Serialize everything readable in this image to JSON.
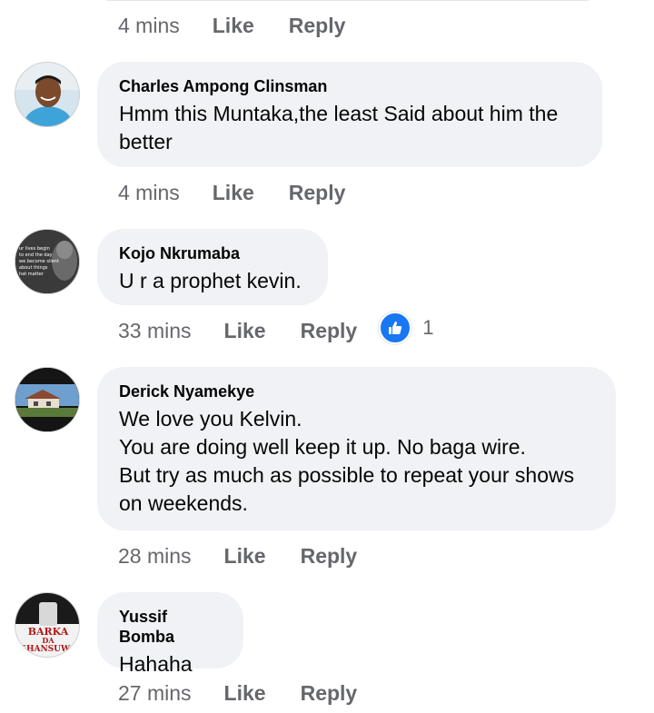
{
  "first_meta": {
    "time": "4 mins",
    "like": "Like",
    "reply": "Reply"
  },
  "comments": [
    {
      "author": "Charles Ampong Clinsman",
      "text": "Hmm this Muntaka,the least Said about him the better",
      "time": "4 mins",
      "like": "Like",
      "reply": "Reply"
    },
    {
      "author": "Kojo Nkrumaba",
      "text": "U r a prophet kevin.",
      "time": "33 mins",
      "like": "Like",
      "reply": "Reply",
      "reaction_count": "1",
      "avatar_text": [
        "ur lives begin",
        "to end the day",
        "we become silent",
        "about things",
        "hat matter"
      ]
    },
    {
      "author": "Derick Nyamekye",
      "text": "We love you Kelvin.\nYou are doing well keep it up. No  baga wire.\nBut try as much as possible to repeat your shows on weekends.",
      "time": "28 mins",
      "like": "Like",
      "reply": "Reply"
    },
    {
      "author": "Yussif Bomba",
      "text": "Hahaha",
      "time": "27 mins",
      "like": "Like",
      "reply": "Reply",
      "avatar_text": [
        "BARKA",
        "DA",
        "SHANSUWA"
      ]
    }
  ],
  "colors": {
    "bubble": "#f0f2f5",
    "meta_text": "#65676b",
    "like_blue": "#1877f2"
  }
}
